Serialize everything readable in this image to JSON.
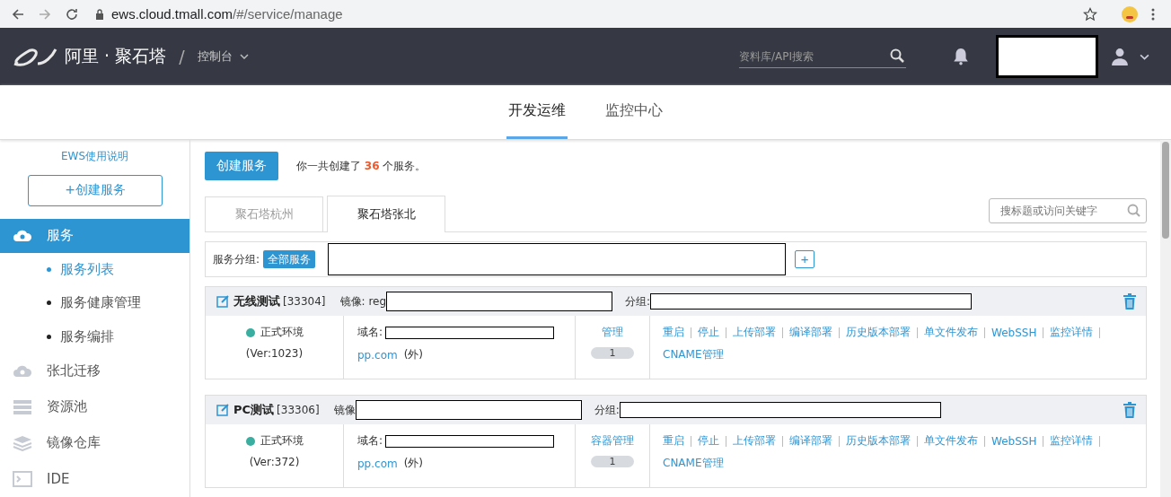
{
  "browser": {
    "url_host": "ews.cloud.tmall.com",
    "url_path": "/#/service/manage"
  },
  "header": {
    "brand": "阿里 · 聚石塔",
    "separator": "/",
    "console": "控制台",
    "search": {
      "placeholder": "资料库/API搜索"
    }
  },
  "nav": [
    {
      "label": "开发运维",
      "selected": true
    },
    {
      "label": "监控中心",
      "selected": false
    }
  ],
  "sidebar": {
    "help_link": "EWS使用说明",
    "create_button": "+创建服务",
    "items": [
      {
        "label": "服务",
        "kind": "cloud",
        "selected": true,
        "children": [
          {
            "label": "服务列表",
            "selected": true
          },
          {
            "label": "服务健康管理",
            "selected": false
          },
          {
            "label": "服务编排",
            "selected": false
          }
        ]
      },
      {
        "label": "张北迁移",
        "kind": "cloud",
        "selected": false
      },
      {
        "label": "资源池",
        "kind": "stack",
        "selected": false
      },
      {
        "label": "镜像仓库",
        "kind": "layers",
        "selected": false
      },
      {
        "label": "IDE",
        "kind": "terminal",
        "selected": false
      }
    ]
  },
  "main": {
    "create_button": "创建服务",
    "summary_before": "你一共创建了",
    "summary_count": "36",
    "summary_after": "个服务。",
    "region_tabs": [
      {
        "label": "聚石塔杭州",
        "selected": false
      },
      {
        "label": "聚石塔张北",
        "selected": true
      }
    ],
    "search": {
      "placeholder": "搜标题或访问关键字"
    },
    "group_label": "服务分组:",
    "group_all": "全部服务",
    "add_group": "+",
    "services": [
      {
        "name": "无线测试",
        "id": "[33304]",
        "image_label": "镜像: reg",
        "group_label": "分组:",
        "env": "正式环境",
        "version": "(Ver:1023)",
        "domain_label": "域名:",
        "domain_tail": "pp.com",
        "domain_scope": "(外)",
        "container_label": "管理",
        "container_count": "1",
        "actions": [
          "重启",
          "停止",
          "上传部署",
          "编译部署",
          "历史版本部署",
          "单文件发布",
          "WebSSH",
          "监控详情",
          "CNAME管理"
        ]
      },
      {
        "name": "PC测试",
        "id": "[33306]",
        "image_label": "镜像",
        "group_label": "分组:",
        "env": "正式环境",
        "version": "(Ver:372)",
        "domain_label": "域名:",
        "domain_tail": "pp.com",
        "domain_scope": "(外)",
        "container_label": "容器管理",
        "container_count": "1",
        "actions": [
          "重启",
          "停止",
          "上传部署",
          "编译部署",
          "历史版本部署",
          "单文件发布",
          "WebSSH",
          "监控详情",
          "CNAME管理"
        ]
      }
    ]
  }
}
